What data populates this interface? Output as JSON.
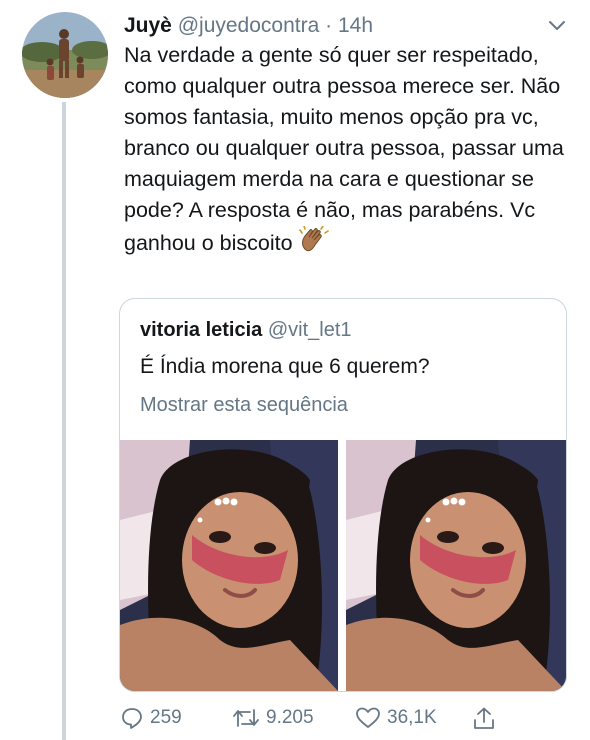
{
  "tweet": {
    "author": {
      "name": "Juyè",
      "handle": "@juyedocontra",
      "avatar_icon": "user-avatar-photo"
    },
    "separator": "·",
    "time": "14h",
    "text": "Na verdade a gente só quer ser respeitado, como qualquer outra pessoa merece ser. Não somos fantasia, muito menos opção pra vc, branco ou qualquer outra pessoa, passar uma maquiagem merda na cara e questionar se pode? A resposta é não, mas parabéns. Vc ganhou o biscoito",
    "emoji": "clapping-hands-icon",
    "actions": {
      "replies": "259",
      "retweets": "9.205",
      "likes": "36,1K"
    }
  },
  "quoted": {
    "name": "vitoria leticia",
    "handle": "@vit_let1",
    "text": "É Índia morena que 6 querem?",
    "link": "Mostrar esta sequência",
    "photos": [
      "selfie-photo-1",
      "selfie-photo-2"
    ]
  },
  "colors": {
    "text": "#14171a",
    "muted": "#657786",
    "border": "#ccd6dd",
    "thread_line": "#ccd6dd"
  }
}
